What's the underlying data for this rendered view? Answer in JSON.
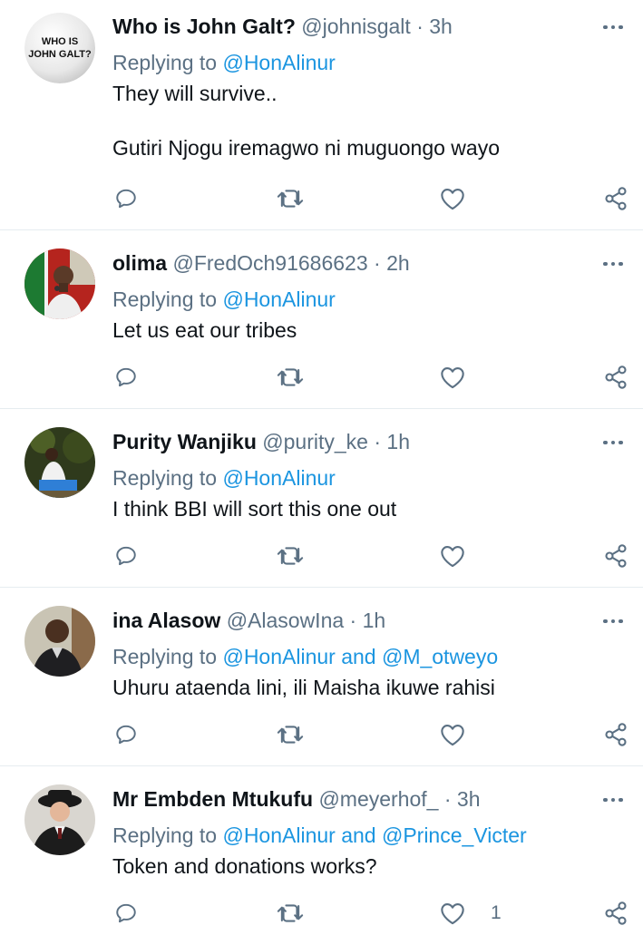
{
  "tweets": [
    {
      "display_name": "Who is John Galt?",
      "handle": "@johnisgalt",
      "time": "3h",
      "replying_prefix": "Replying to ",
      "mention1": "@HonAlinur",
      "mention_join": "",
      "mention2": "",
      "text": "They will survive..\n\nGutiri Njogu iremagwo ni muguongo wayo",
      "like_count": "",
      "avatar_text_line1": "WHO IS",
      "avatar_text_line2": "JOHN GALT?"
    },
    {
      "display_name": "olima",
      "handle": "@FredOch91686623",
      "time": "2h",
      "replying_prefix": "Replying to ",
      "mention1": "@HonAlinur",
      "mention_join": "",
      "mention2": "",
      "text": "Let us eat our tribes",
      "like_count": ""
    },
    {
      "display_name": "Purity Wanjiku",
      "handle": "@purity_ke",
      "time": "1h",
      "replying_prefix": "Replying to ",
      "mention1": "@HonAlinur",
      "mention_join": "",
      "mention2": "",
      "text": "I think BBI will sort this one out",
      "like_count": ""
    },
    {
      "display_name": "ina Alasow",
      "handle": "@AlasowIna",
      "time": "1h",
      "replying_prefix": "Replying to ",
      "mention1": "@HonAlinur",
      "mention_join": " and ",
      "mention2": "@M_otweyo",
      "text": "Uhuru ataenda lini, ili Maisha ikuwe rahisi",
      "like_count": ""
    },
    {
      "display_name": "Mr Embden Mtukufu",
      "handle": "@meyerhof_",
      "time": "3h",
      "replying_prefix": "Replying to ",
      "mention1": "@HonAlinur",
      "mention_join": " and ",
      "mention2": "@Prince_Victer",
      "text": "Token and donations works?",
      "like_count": "1"
    }
  ],
  "separator": "·",
  "colors": {
    "text": "#0f1419",
    "secondary": "#5b7083",
    "link": "#1b95e0",
    "divider": "#e6ecf0"
  },
  "icons": [
    "more-icon",
    "reply-icon",
    "retweet-icon",
    "like-icon",
    "share-icon"
  ]
}
